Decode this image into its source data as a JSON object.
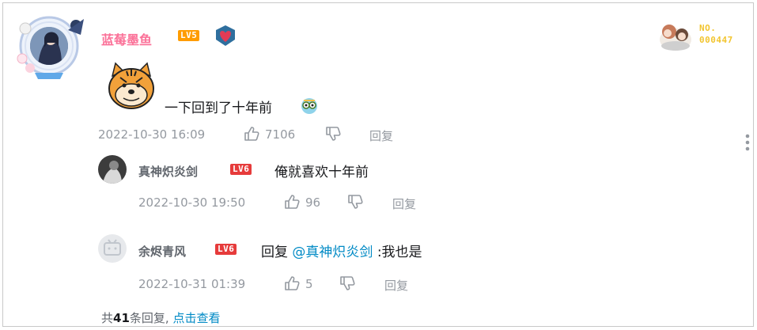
{
  "main": {
    "username": "蓝莓墨鱼",
    "level": "LV5",
    "content": "一下回到了十年前",
    "date": "2022-10-30 16:09",
    "likes": "7106",
    "reply_label": "回复",
    "fan_card_no": "NO.",
    "fan_card_num": "000447"
  },
  "replies": [
    {
      "username": "真神炽炎剑",
      "level": "LV6",
      "content": "俺就喜欢十年前",
      "date": "2022-10-30 19:50",
      "likes": "96",
      "reply_label": "回复"
    },
    {
      "username": "余烬青风",
      "level": "LV6",
      "reply_prefix": "回复",
      "mention": "@真神炽炎剑",
      "content": ":我也是",
      "date": "2022-10-31 01:39",
      "likes": "5",
      "reply_label": "回复"
    }
  ],
  "footer": {
    "prefix": "共",
    "count": "41",
    "suffix": "条回复,",
    "link": "点击查看"
  },
  "colors": {
    "username_pink": "#fb7299",
    "link_blue": "#008ac5",
    "meta_gray": "#9499a0"
  }
}
